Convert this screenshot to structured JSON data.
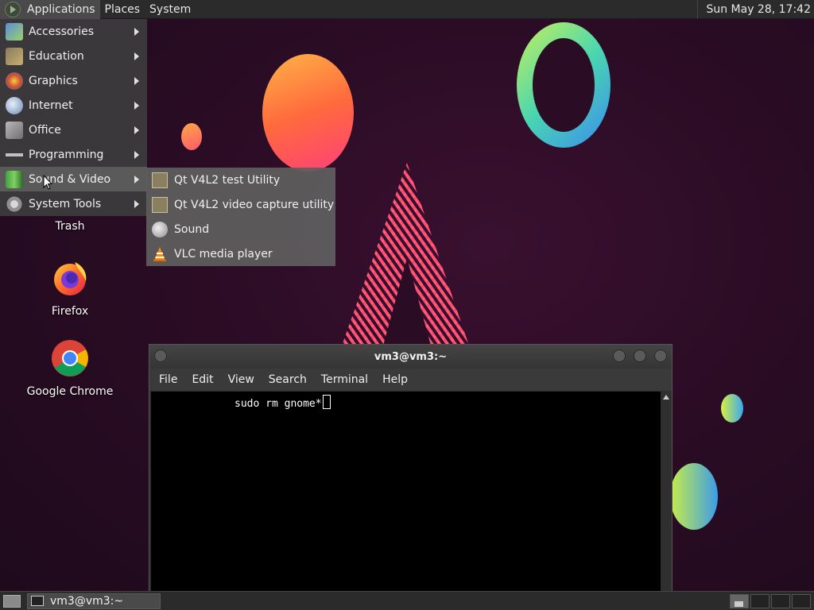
{
  "top_panel": {
    "menus": [
      "Applications",
      "Places",
      "System"
    ],
    "clock": "Sun May 28, 17:42"
  },
  "apps_menu": {
    "items": [
      {
        "label": "Accessories",
        "icon": "accessories-icon"
      },
      {
        "label": "Education",
        "icon": "education-icon"
      },
      {
        "label": "Graphics",
        "icon": "graphics-icon"
      },
      {
        "label": "Internet",
        "icon": "internet-icon"
      },
      {
        "label": "Office",
        "icon": "office-icon"
      },
      {
        "label": "Programming",
        "icon": "programming-icon"
      },
      {
        "label": "Sound & Video",
        "icon": "sound-video-icon"
      },
      {
        "label": "System Tools",
        "icon": "system-tools-icon"
      }
    ],
    "hovered": "Sound & Video"
  },
  "sound_video_submenu": {
    "items": [
      {
        "label": "Qt V4L2 test Utility",
        "icon": "qt-v4l2-icon"
      },
      {
        "label": "Qt V4L2 video capture utility",
        "icon": "qt-v4l2-capture-icon"
      },
      {
        "label": "Sound",
        "icon": "sound-icon"
      },
      {
        "label": "VLC media player",
        "icon": "vlc-icon"
      }
    ]
  },
  "desktop_icons": [
    {
      "label": "Trash",
      "icon": "trash-icon"
    },
    {
      "label": "Firefox",
      "icon": "firefox-icon"
    },
    {
      "label": "Google Chrome",
      "icon": "chrome-icon"
    }
  ],
  "terminal": {
    "title": "vm3@vm3:~",
    "menus": [
      "File",
      "Edit",
      "View",
      "Search",
      "Terminal",
      "Help"
    ],
    "command_line": "sudo rm gnome*"
  },
  "bottom_panel": {
    "task_label": "vm3@vm3:~"
  },
  "colors": {
    "panel_bg": "#2b2b2b",
    "menu_bg": "#3c3c3c",
    "terminal_bg": "#000000",
    "wallpaper": "#2a0c24"
  }
}
